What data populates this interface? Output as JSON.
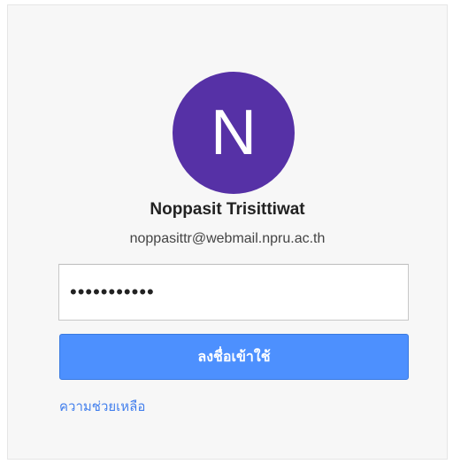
{
  "account": {
    "avatar_letter": "N",
    "avatar_color": "#5631a6",
    "name": "Noppasit Trisittiwat",
    "email": "noppasittr@webmail.npru.ac.th"
  },
  "form": {
    "password_value": "•••••••••••",
    "signin_label": "ลงชื่อเข้าใช้",
    "signin_color": "#4d90fe",
    "help_link": "ความช่วยเหลือ",
    "link_color": "#427fed"
  }
}
